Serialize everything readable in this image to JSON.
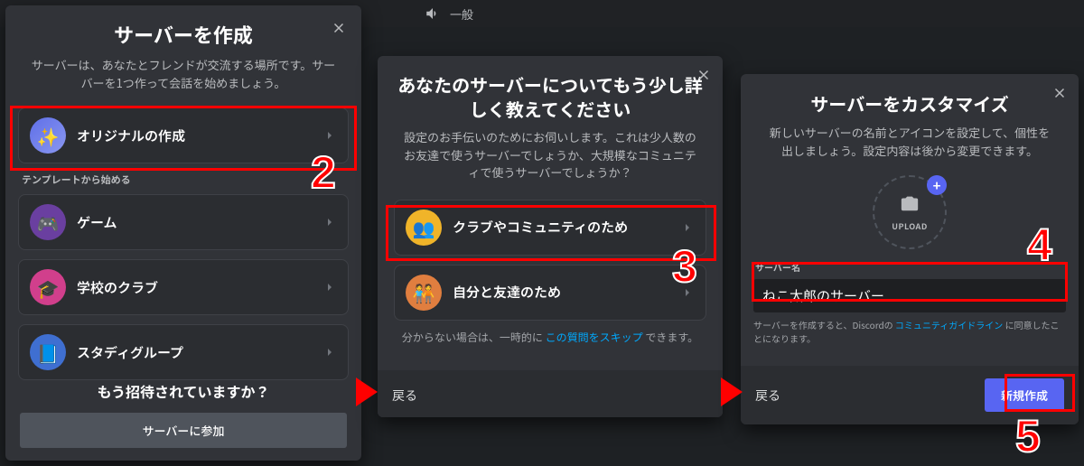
{
  "topbar": {
    "channel": "一般"
  },
  "modal1": {
    "title": "サーバーを作成",
    "desc": "サーバーは、あなたとフレンドが交流する場所です。サーバーを1つ作って会話を始めましょう。",
    "create_original": "オリジナルの作成",
    "templates_label": "テンプレートから始める",
    "template_game": "ゲーム",
    "template_school": "学校のクラブ",
    "template_study": "スタディグループ",
    "invited_q": "もう招待されていますか？",
    "join_btn": "サーバーに参加"
  },
  "modal2": {
    "title": "あなたのサーバーについてもう少し詳しく教えてください",
    "desc": "設定のお手伝いのためにお伺いします。これは少人数のお友達で使うサーバーでしょうか、大規模なコミュニティで使うサーバーでしょうか？",
    "opt_club": "クラブやコミュニティのため",
    "opt_friends": "自分と友達のため",
    "skip_pre": "分からない場合は、一時的に",
    "skip_link": "この質問をスキップ",
    "skip_post": "できます。",
    "back": "戻る"
  },
  "modal3": {
    "title": "サーバーをカスタマイズ",
    "desc": "新しいサーバーの名前とアイコンを設定して、個性を出しましょう。設定内容は後から変更できます。",
    "upload": "UPLOAD",
    "field_label": "サーバー名",
    "server_name": "ねこ太郎のサーバー",
    "guideline_pre": "サーバーを作成すると、Discordの",
    "guideline_link": "コミュニティガイドライン",
    "guideline_post": "に同意したことになります。",
    "back": "戻る",
    "create_btn": "新規作成"
  },
  "annotations": {
    "n2": "2",
    "n3": "3",
    "n4": "4",
    "n5": "5"
  }
}
